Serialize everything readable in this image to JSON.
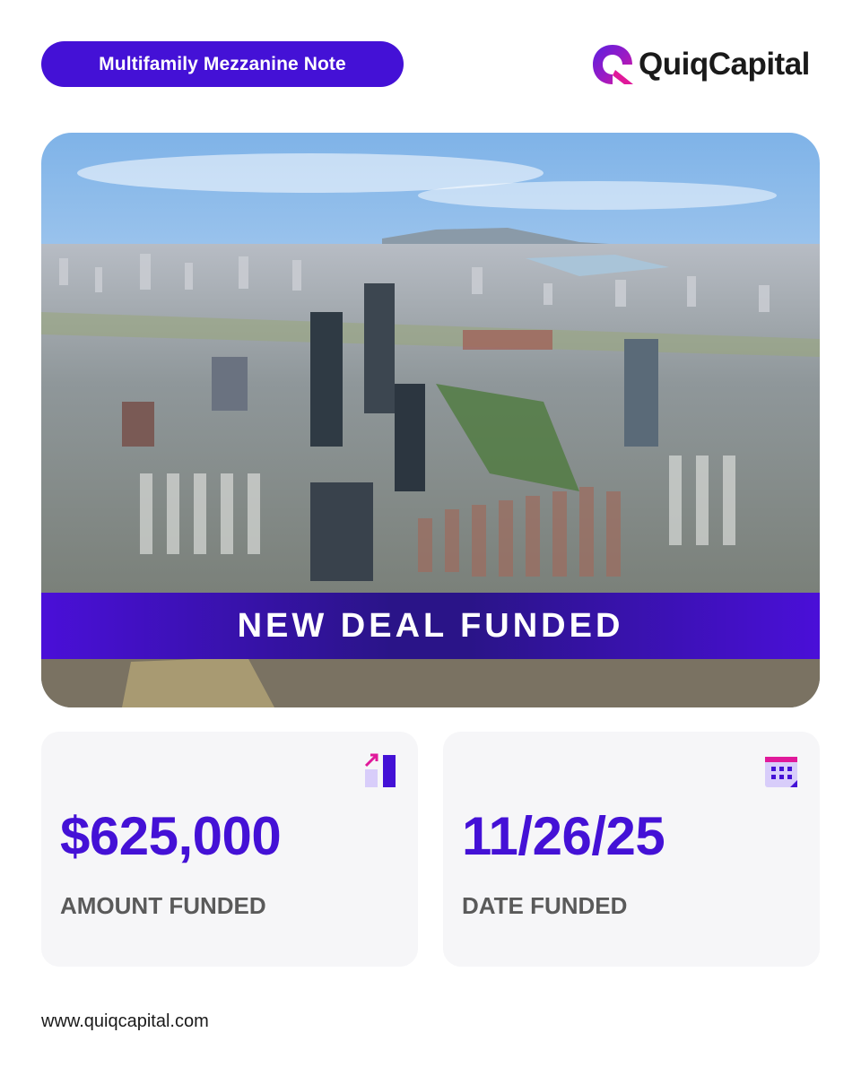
{
  "header": {
    "tag_label": "Multifamily Mezzanine Note",
    "brand_name": "QuiqCapital",
    "brand_colors": {
      "primary": "#4411d6",
      "accent": "#d81b8f"
    }
  },
  "hero": {
    "banner_text": "NEW DEAL FUNDED"
  },
  "stats": {
    "amount": {
      "value": "$625,000",
      "label": "AMOUNT FUNDED",
      "icon": "growth-chart-icon"
    },
    "date": {
      "value": "11/26/25",
      "label": "DATE FUNDED",
      "icon": "calendar-icon"
    }
  },
  "footer": {
    "url": "www.quiqcapital.com"
  }
}
